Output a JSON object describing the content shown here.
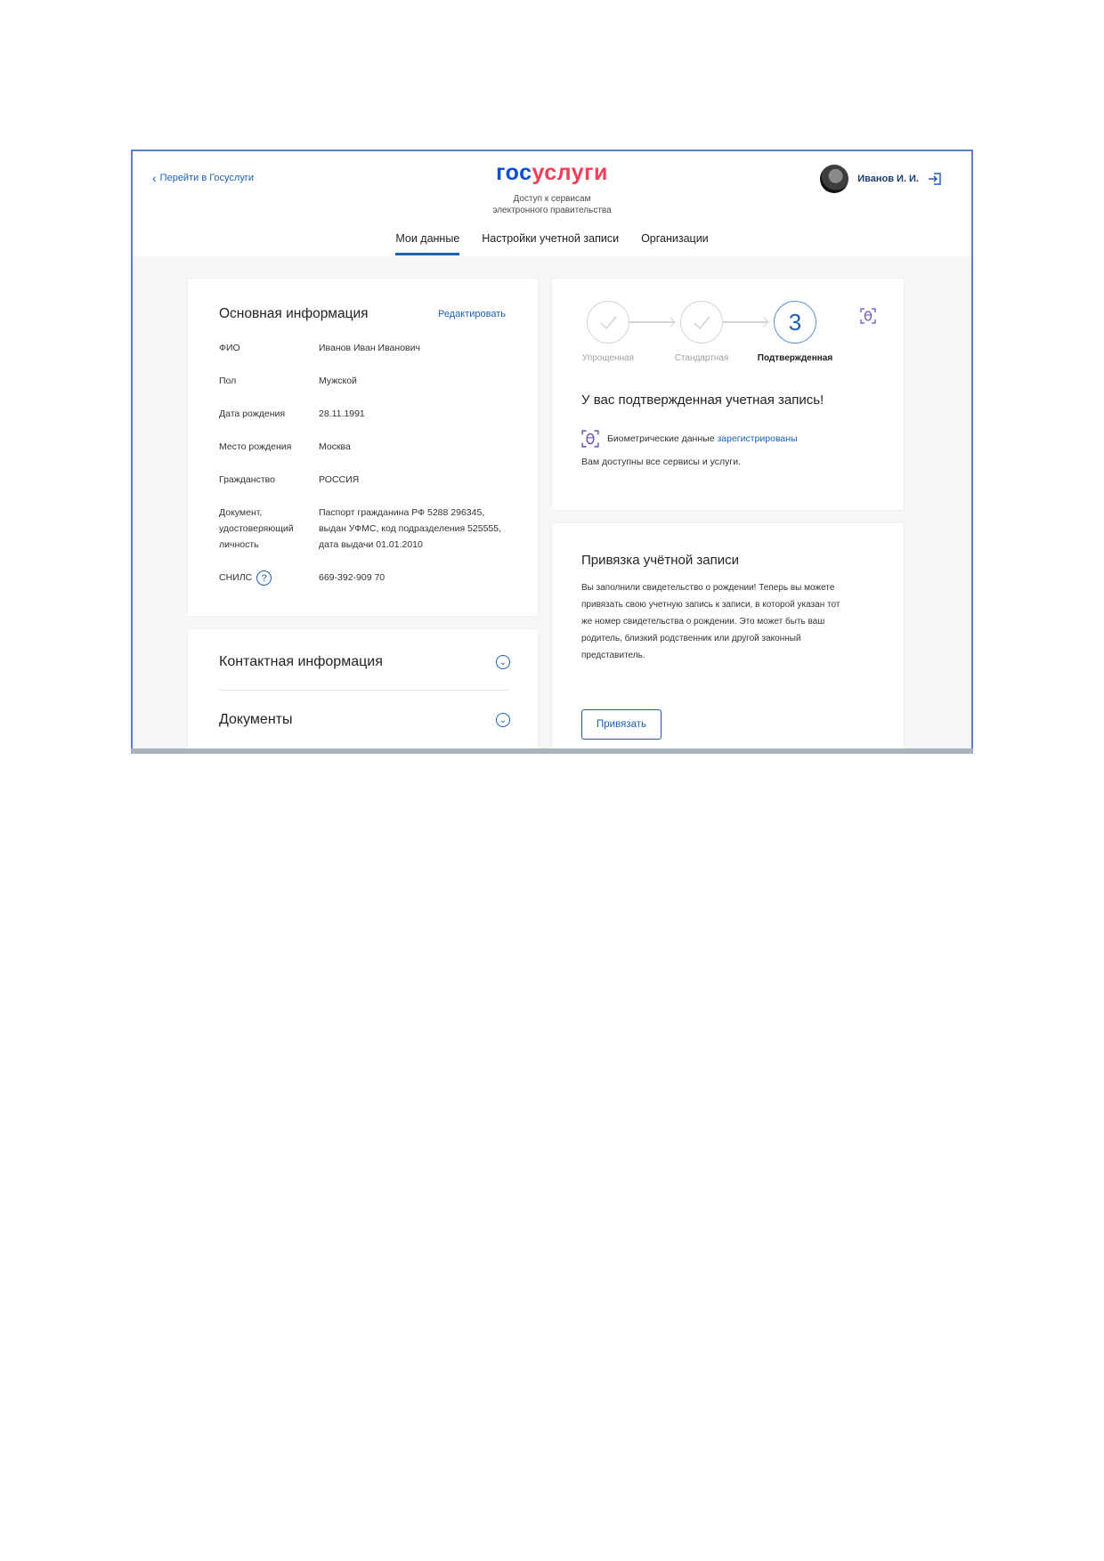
{
  "header": {
    "back_link": "Перейти в Госуслуги",
    "logo_part1": "гос",
    "logo_part2": "услуги",
    "tagline_line1": "Доступ к сервисам",
    "tagline_line2": "электронного правительства",
    "user_name": "Иванов И. И.",
    "brand_blue": "#0d4cd3",
    "brand_red": "#ee3f58"
  },
  "tabs": [
    {
      "label": "Мои данные",
      "active": true
    },
    {
      "label": "Настройки учетной записи",
      "active": false
    },
    {
      "label": "Организации",
      "active": false
    }
  ],
  "main_info": {
    "title": "Основная информация",
    "edit_label": "Редактировать",
    "fields": [
      {
        "label": "ФИО",
        "value": "Иванов Иван Иванович"
      },
      {
        "label": "Пол",
        "value": "Мужской"
      },
      {
        "label": "Дата рождения",
        "value": "28.11.1991"
      },
      {
        "label": "Место рождения",
        "value": "Москва"
      },
      {
        "label": "Гражданство",
        "value": "РОССИЯ"
      },
      {
        "label": "Документ, удостоверяющий личность",
        "value": "Паспорт гражданина РФ 5288 296345, выдан УФМС, код подразделения 525555, дата выдачи 01.01.2010"
      },
      {
        "label": "СНИЛС",
        "value": "669-392-909 70",
        "help_icon": "?"
      }
    ]
  },
  "accordion": [
    {
      "title": "Контактная информация",
      "icon": "chevron-down-icon"
    },
    {
      "title": "Документы",
      "icon": "chevron-down-icon"
    }
  ],
  "account_status": {
    "steps": [
      {
        "label": "Упрощенная",
        "state": "done"
      },
      {
        "label": "Стандартная",
        "state": "done"
      },
      {
        "label": "Подтвержденная",
        "state": "current",
        "number": "3"
      }
    ],
    "title": "У вас подтвержденная учетная запись!",
    "biometric_text": "Биометрические данные",
    "biometric_link": "зарегистрированы",
    "services_text": "Вам доступны все сервисы и услуги."
  },
  "binding": {
    "title": "Привязка учётной записи",
    "text": "Вы заполнили свидетельство о рождении! Теперь вы можете привязать свою учетную запись к записи, в которой указан тот же номер свидетельства о рождении. Это может быть ваш родитель, близкий родственник или другой законный представитель.",
    "button_label": "Привязать"
  },
  "colors": {
    "accent": "#1c5fb5",
    "page_bg": "#f4f6f8"
  }
}
